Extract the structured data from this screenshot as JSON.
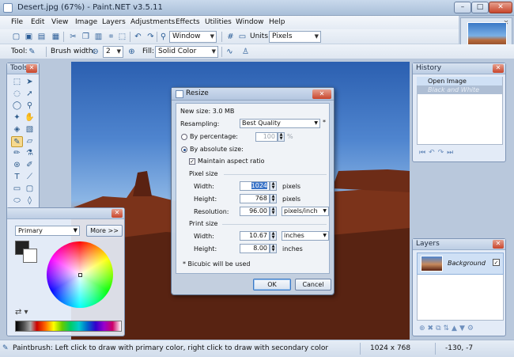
{
  "window": {
    "title": "Desert.jpg (67%) - Paint.NET v3.5.11",
    "min": "–",
    "max": "□",
    "close": "✕"
  },
  "menu": [
    "File",
    "Edit",
    "View",
    "Image",
    "Layers",
    "Adjustments",
    "Effects",
    "Utilities",
    "Window",
    "Help"
  ],
  "toolbar": {
    "window_label": "Window",
    "units_label": "Units:",
    "units_value": "Pixels",
    "tool_label": "Tool:",
    "brush_width_label": "Brush width:",
    "brush_width_value": "2",
    "fill_label": "Fill:",
    "fill_value": "Solid Color"
  },
  "tools": {
    "title": "Tools"
  },
  "colors": {
    "select_value": "Primary",
    "more_button": "More >>"
  },
  "history": {
    "title": "History",
    "items": [
      "Open Image",
      "Black and White"
    ]
  },
  "layers": {
    "title": "Layers",
    "items": [
      {
        "name": "Background",
        "visible": true
      }
    ]
  },
  "resize_dialog": {
    "title": "Resize",
    "new_size": "New size: 3.0 MB",
    "resampling_label": "Resampling:",
    "resampling_value": "Best Quality",
    "asterisk": "*",
    "by_percentage_label": "By percentage:",
    "percentage_value": "100",
    "percent_unit": "%",
    "by_absolute_label": "By absolute size:",
    "maintain_aspect_label": "Maintain aspect ratio",
    "pixel_size_header": "Pixel size",
    "width_label": "Width:",
    "width_value": "1024",
    "width_unit": "pixels",
    "height_label": "Height:",
    "height_value": "768",
    "height_unit": "pixels",
    "resolution_label": "Resolution:",
    "resolution_value": "96.00",
    "resolution_unit": "pixels/inch",
    "print_size_header": "Print size",
    "print_width_label": "Width:",
    "print_width_value": "10.67",
    "print_width_unit": "inches",
    "print_height_label": "Height:",
    "print_height_value": "8.00",
    "print_height_unit": "inches",
    "footnote": "* Bicubic will be used",
    "ok_label": "OK",
    "cancel_label": "Cancel"
  },
  "status": {
    "message": "Paintbrush: Left click to draw with primary color, right click to draw with secondary color",
    "image_size": "1024 x 768",
    "cursor": "-130, -7"
  }
}
